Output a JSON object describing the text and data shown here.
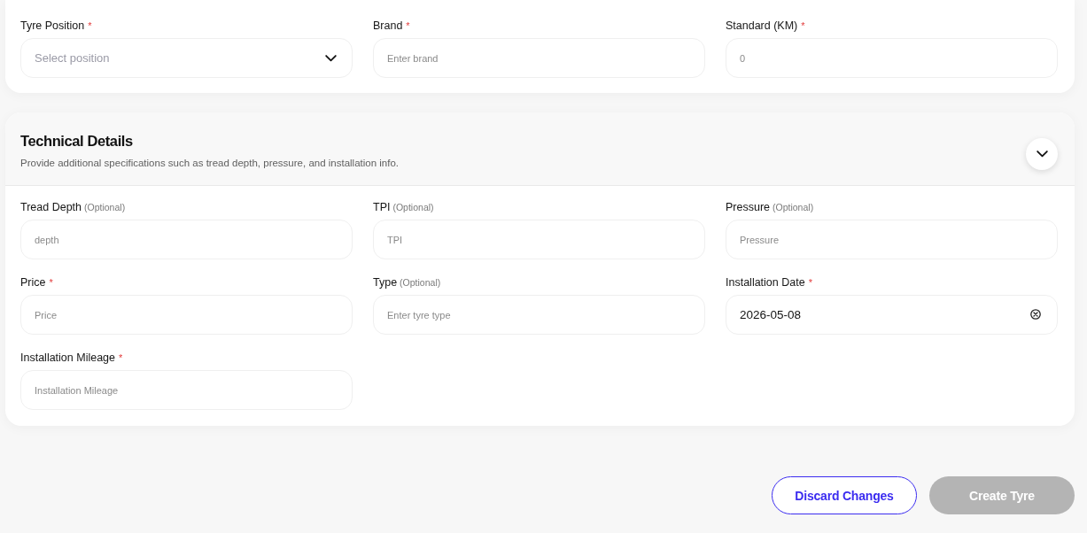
{
  "sections": [
    {
      "kind": "continued",
      "fields": [
        {
          "kind": "select",
          "label": "Tyre Position",
          "required_mark": "*",
          "placeholder": "Select position"
        },
        {
          "kind": "text",
          "label": "Brand",
          "required_mark": "*",
          "placeholder": "Enter brand"
        },
        {
          "kind": "text",
          "label": "Standard (KM)",
          "required_mark": "*",
          "placeholder": "0"
        }
      ]
    },
    {
      "kind": "collapsible",
      "title": "Technical Details",
      "subtitle": "Provide additional specifications such as tread depth, pressure, and installation info.",
      "expanded": true,
      "fields": [
        {
          "kind": "text",
          "label": "Tread Depth",
          "optional_note": "(Optional)",
          "placeholder": "depth"
        },
        {
          "kind": "text",
          "label": "TPI",
          "optional_note": "(Optional)",
          "placeholder": "TPI"
        },
        {
          "kind": "text",
          "label": "Pressure",
          "optional_note": "(Optional)",
          "placeholder": "Pressure"
        },
        {
          "kind": "text",
          "label": "Price",
          "required_mark": "*",
          "placeholder": "Price"
        },
        {
          "kind": "text",
          "label": "Type",
          "optional_note": "(Optional)",
          "placeholder": "Enter tyre type"
        },
        {
          "kind": "date",
          "label": "Installation Date",
          "required_mark": "*",
          "value": "2026-05-08",
          "clearable": true
        },
        {
          "kind": "text",
          "label": "Installation Mileage",
          "required_mark": "*",
          "placeholder": "Installation Mileage"
        }
      ]
    }
  ],
  "actions": [
    {
      "kind": "outline",
      "label": "Discard Changes",
      "disabled": false
    },
    {
      "kind": "filled",
      "label": "Create Tyre",
      "disabled": true
    }
  ]
}
